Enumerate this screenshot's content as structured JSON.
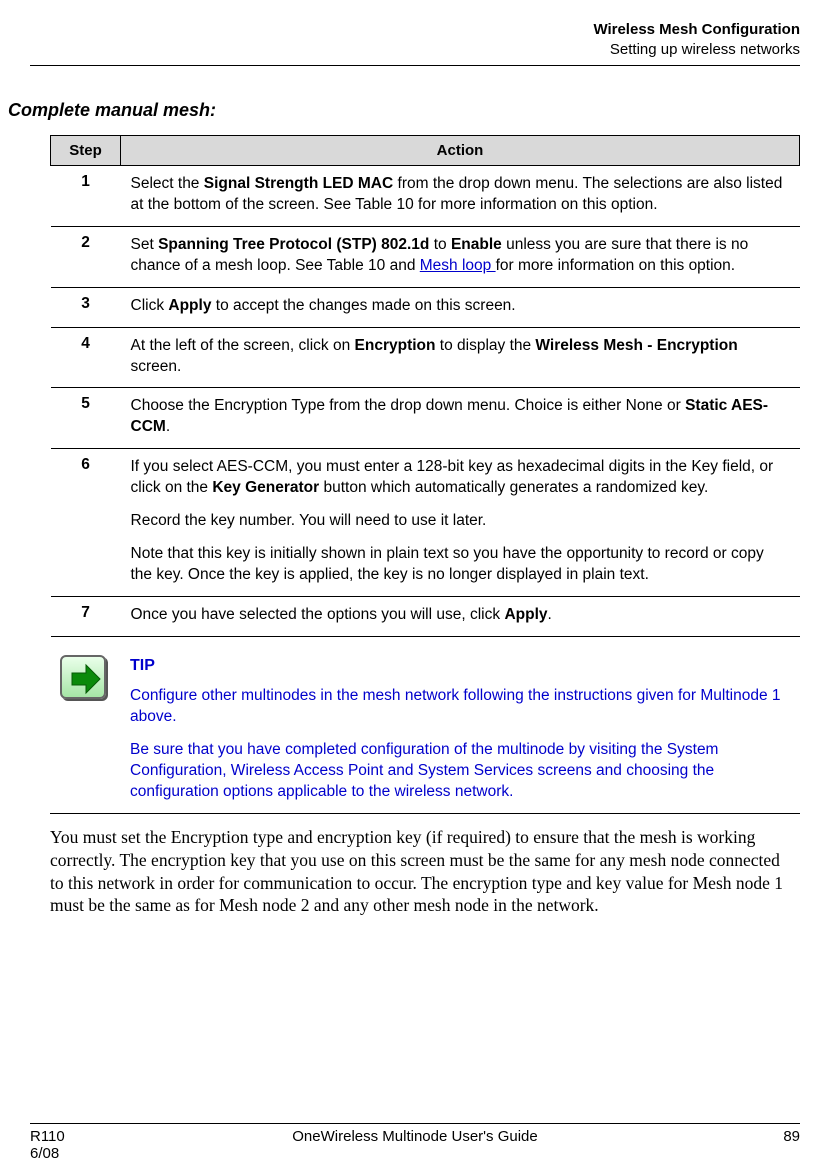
{
  "header": {
    "title": "Wireless Mesh Configuration",
    "subtitle": "Setting up wireless networks"
  },
  "section_title": "Complete manual mesh:",
  "table": {
    "col_step": "Step",
    "col_action": "Action",
    "rows": [
      {
        "num": "1",
        "parts": [
          {
            "t": "Select the "
          },
          {
            "t": "Signal Strength LED MAC",
            "b": true
          },
          {
            "t": " from the drop down menu.  The selections are also listed at the bottom of the screen.  See Table 10 for more information on this option."
          }
        ]
      },
      {
        "num": "2",
        "parts": [
          {
            "t": "Set "
          },
          {
            "t": "Spanning Tree Protocol (STP) 802.1d",
            "b": true
          },
          {
            "t": " to "
          },
          {
            "t": "Enable",
            "b": true
          },
          {
            "t": " unless you are sure that there is no chance of a mesh loop.  See Table 10  and "
          },
          {
            "t": "Mesh loop ",
            "link": true
          },
          {
            "t": "for more information on this option."
          }
        ]
      },
      {
        "num": "3",
        "parts": [
          {
            "t": "Click "
          },
          {
            "t": "Apply",
            "b": true
          },
          {
            "t": " to accept the changes made on this screen."
          }
        ]
      },
      {
        "num": "4",
        "parts": [
          {
            "t": "At the left of the screen, click on "
          },
          {
            "t": "Encryption",
            "b": true
          },
          {
            "t": " to display the "
          },
          {
            "t": "Wireless Mesh - Encryption",
            "b": true
          },
          {
            "t": " screen."
          }
        ]
      },
      {
        "num": "5",
        "parts": [
          {
            "t": "Choose the Encryption Type from the drop down menu.  Choice is either None or "
          },
          {
            "t": "Static AES-CCM",
            "b": true
          },
          {
            "t": "."
          }
        ]
      },
      {
        "num": "6",
        "paragraphs": [
          [
            {
              "t": "If you select AES-CCM, you must enter a 128-bit key as hexadecimal digits in the Key field, or click on the "
            },
            {
              "t": "Key Generator",
              "b": true
            },
            {
              "t": " button which automatically generates a randomized key."
            }
          ],
          [
            {
              "t": "Record the key number.  You will need to use it later."
            }
          ],
          [
            {
              "t": "Note that this key is initially shown in plain text so you have the opportunity to record or copy the key. Once the key is applied, the key is no longer displayed in plain text."
            }
          ]
        ]
      },
      {
        "num": "7",
        "parts": [
          {
            "t": "Once you have selected the options you will use, click "
          },
          {
            "t": "Apply",
            "b": true
          },
          {
            "t": "."
          }
        ]
      }
    ]
  },
  "tip": {
    "label": "TIP",
    "p1": "Configure other multinodes in the mesh network following the instructions given for Multinode 1 above.",
    "p2": "Be sure that you have completed configuration of the multinode by visiting the System Configuration, Wireless Access Point and System Services screens and choosing the configuration options applicable to the wireless network."
  },
  "body_para": "You must set the Encryption type and encryption key (if required) to ensure that the mesh is working correctly. The encryption key that you use on this screen must be the same for any mesh node connected to this network in order for communication to occur.  The encryption type and key value for Mesh node 1 must be the same as for Mesh node 2 and any other mesh node in the network.",
  "footer": {
    "left1": "R110",
    "left2": "6/08",
    "center": "OneWireless Multinode User's Guide",
    "right": "89"
  }
}
